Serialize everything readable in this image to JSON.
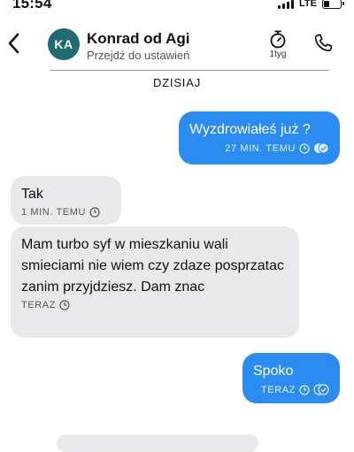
{
  "status_bar": {
    "time": "15:54",
    "network": "LTE"
  },
  "header": {
    "avatar_initials": "KA",
    "contact_name": "Konrad od Agi",
    "subtitle": "Przejdź do ustawień",
    "timer_label": "1tyg",
    "icons": [
      "back-chevron-icon",
      "timer-icon",
      "phone-icon"
    ]
  },
  "date_separator": "DZISIAJ",
  "messages": [
    {
      "direction": "outgoing",
      "text": "Wyzdrowiałeś już ?",
      "time": "27 MIN. TEMU",
      "status": "read"
    },
    {
      "direction": "incoming",
      "text": "Tak",
      "time": "1 MIN. TEMU"
    },
    {
      "direction": "incoming",
      "text": "Mam turbo syf w mieszkaniu wali smieciami nie wiem czy zdaze posprzatac zanim przyjdziesz. Dam znac",
      "time": "TERAZ"
    },
    {
      "direction": "outgoing",
      "text": "Spoko",
      "time": "TERAZ",
      "status": "read"
    }
  ],
  "colors": {
    "outgoing_bubble": "#2a8cf0",
    "incoming_bubble": "#e9e9ec",
    "avatar": "#1f6b73"
  }
}
